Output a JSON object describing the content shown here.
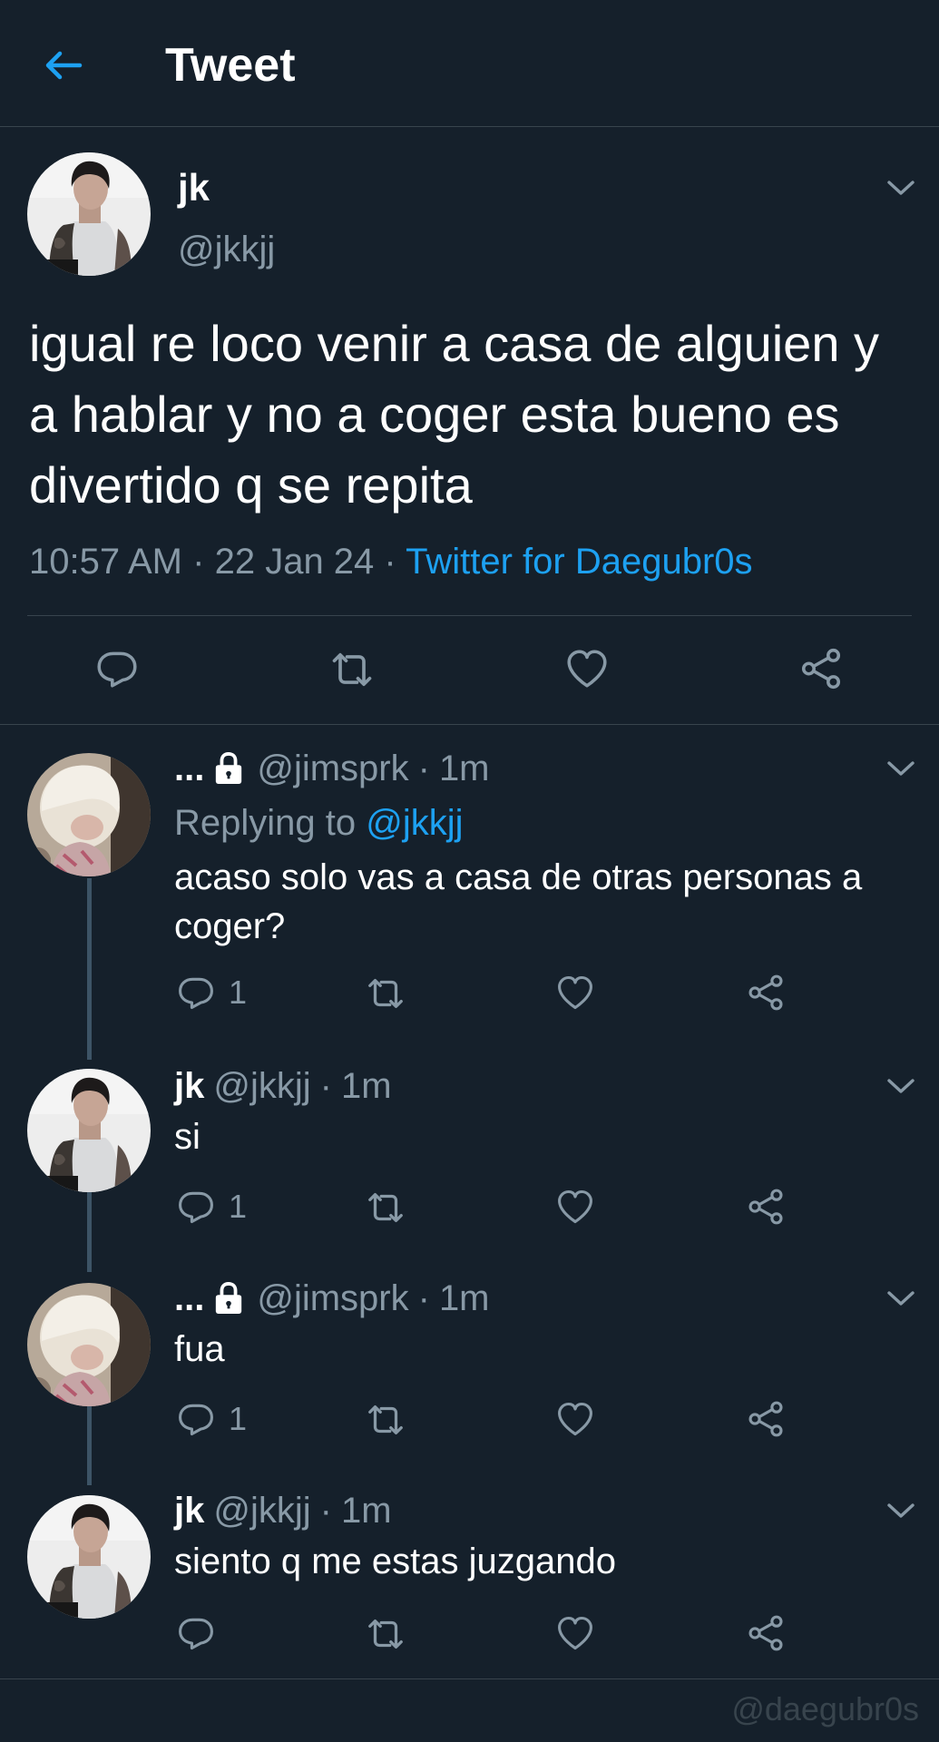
{
  "header": {
    "title": "Tweet",
    "back_icon": "arrow-left-icon",
    "accent": "#1da1f2"
  },
  "main_tweet": {
    "name": "jk",
    "handle": "@jkkjj",
    "text": "igual re loco venir a casa de alguien y a hablar y no a coger esta bueno es divertido q se repita",
    "time": "10:57 AM",
    "date": "22 Jan 24",
    "source": "Twitter for Daegubr0s",
    "actions": [
      "reply-icon",
      "retweet-icon",
      "like-icon",
      "share-icon"
    ]
  },
  "replies": [
    {
      "name": "...",
      "locked": true,
      "handle": "@jimsprk",
      "time": "1m",
      "replying_label": "Replying to",
      "replying_to": "@jkkjj",
      "text": "acaso solo vas a casa de otras personas a coger?",
      "reply_count": "1"
    },
    {
      "name": "jk",
      "locked": false,
      "handle": "@jkkjj",
      "time": "1m",
      "text": "si",
      "reply_count": "1"
    },
    {
      "name": "...",
      "locked": true,
      "handle": "@jimsprk",
      "time": "1m",
      "text": "fua",
      "reply_count": "1"
    },
    {
      "name": "jk",
      "locked": false,
      "handle": "@jkkjj",
      "time": "1m",
      "text": "siento q me estas juzgando",
      "reply_count": ""
    }
  ],
  "separator": "·",
  "watermark": "@daegubr0s",
  "colors": {
    "background": "#15202b",
    "secondary_text": "#8899a6",
    "divider": "#38444d",
    "link": "#1da1f2"
  }
}
